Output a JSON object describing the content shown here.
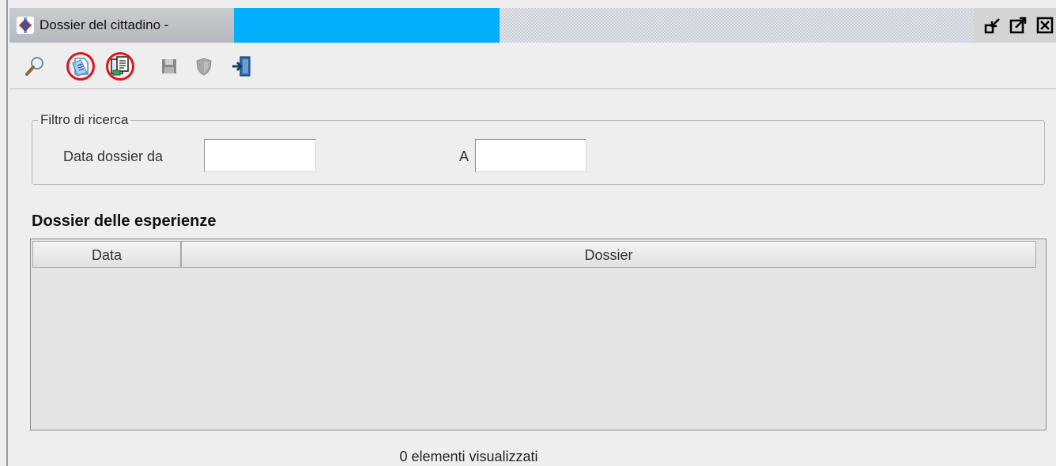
{
  "window": {
    "title": "Dossier del cittadino -"
  },
  "toolbar": {
    "items": [
      {
        "icon": "search-icon"
      },
      {
        "icon": "document-icon"
      },
      {
        "icon": "copy-documents-icon"
      },
      {
        "icon": "save-icon"
      },
      {
        "icon": "shield-icon"
      },
      {
        "icon": "exit-icon"
      }
    ]
  },
  "filter": {
    "legend": "Filtro di ricerca",
    "date_from_label": "Data dossier da",
    "date_from_value": "",
    "date_to_label": "A",
    "date_to_value": ""
  },
  "dossier_table": {
    "title": "Dossier delle esperienze",
    "columns": [
      "Data",
      "Dossier"
    ],
    "rows": []
  },
  "status": {
    "count_text": "0 elementi visualizzati"
  },
  "colors": {
    "redaction": "#00b0ff",
    "highlight_circle": "#e0141a"
  }
}
